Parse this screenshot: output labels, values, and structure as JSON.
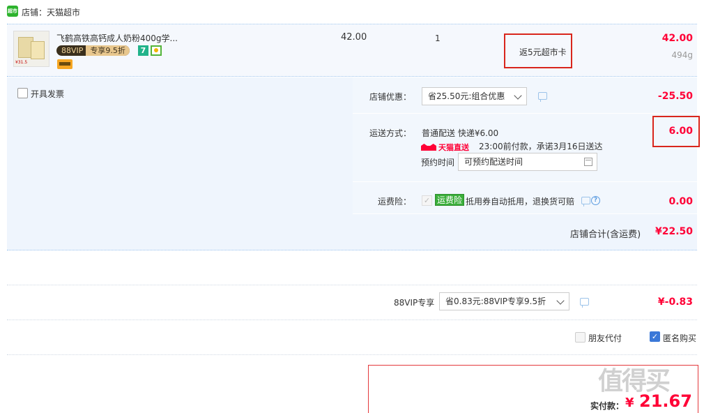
{
  "shop": {
    "icon_text": "超市",
    "name": "店铺：天猫超市"
  },
  "item": {
    "thumb_tag": "¥31.5",
    "title": "飞鹤高铁高钙成人奶粉400g学...",
    "vip_left": "88VIP",
    "vip_right": "专享9.5折",
    "badge_seven": "7",
    "unit_price": "42.00",
    "quantity": "1",
    "rebate": "返5元超市卡",
    "subtotal": "42.00",
    "weight": "494g"
  },
  "invoice": {
    "label": "开具发票"
  },
  "discount": {
    "label": "店铺优惠：",
    "selected": "省25.50元:组合优惠",
    "amount": "-25.50"
  },
  "shipping": {
    "label": "运送方式：",
    "method": "普通配送 快递¥6.00",
    "tmall_direct": "天猫直送",
    "promise": "23:00前付款，承诺3月16日送达",
    "schedule_label": "预约时间",
    "schedule_value": "可预约配送时间",
    "amount": "6.00"
  },
  "insurance": {
    "label": "运费险：",
    "tag": "运费险",
    "desc": "抵用券自动抵用，退换货可赔",
    "help": "?",
    "amount": "0.00"
  },
  "shop_total": {
    "label": "店铺合计(含运费)",
    "value": "¥22.50"
  },
  "vip_discount": {
    "label": "88VIP专享",
    "selected": "省0.83元:88VIP专享9.5折",
    "amount": "¥-0.83"
  },
  "options": {
    "friend_pay": "朋友代付",
    "anonymous": "匿名购买",
    "anon_check": "✓",
    "ins_check": "✓"
  },
  "pay": {
    "label": "实付款：",
    "currency": "¥",
    "amount": "21.67"
  },
  "watermark": "值得买"
}
